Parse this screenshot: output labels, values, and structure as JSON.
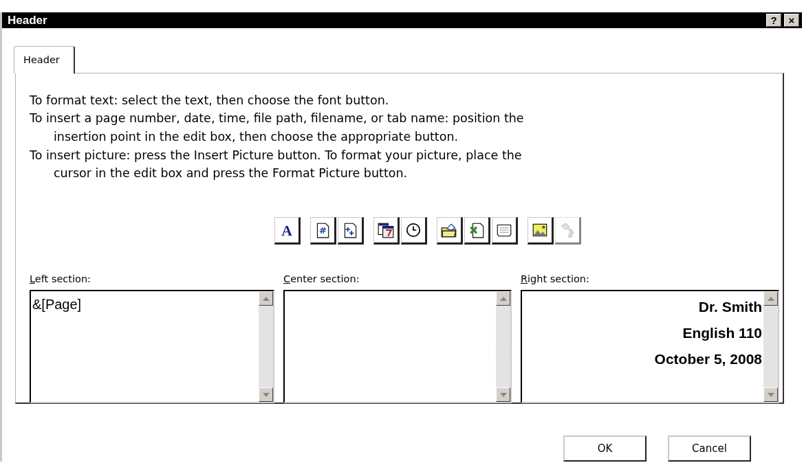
{
  "window": {
    "title": "Header",
    "help_button": "?",
    "close_button": "×"
  },
  "tabs": [
    {
      "label": "Header",
      "selected": true
    }
  ],
  "instructions": [
    {
      "lines": [
        "To format text:  select the text, then choose the font button."
      ]
    },
    {
      "lines": [
        "To insert a page number, date, time, file path, filename, or tab name:  position the",
        "insertion point in the edit box, then choose the appropriate button."
      ]
    },
    {
      "lines": [
        "To insert picture: press the Insert Picture button.  To format your picture, place the",
        "cursor in the edit box and press the Format Picture button."
      ]
    }
  ],
  "toolbar": [
    [
      {
        "kind": "font",
        "glyph": "A",
        "disabled": false
      }
    ],
    [
      {
        "kind": "page-number",
        "glyph": "#",
        "disabled": false
      },
      {
        "kind": "page-count",
        "disabled": false
      }
    ],
    [
      {
        "kind": "date",
        "disabled": false
      },
      {
        "kind": "time",
        "disabled": false
      }
    ],
    [
      {
        "kind": "file-path",
        "disabled": false
      },
      {
        "kind": "file-name",
        "disabled": false
      },
      {
        "kind": "sheet-name",
        "disabled": false
      }
    ],
    [
      {
        "kind": "picture",
        "disabled": false
      },
      {
        "kind": "format-picture",
        "disabled": true
      }
    ]
  ],
  "sections": [
    {
      "label": "Left section:",
      "lines": [
        "&[Page]"
      ]
    },
    {
      "label": "Center section:"
    },
    {
      "label": "Right section:",
      "bold": true,
      "lines": [
        "Dr. Smith",
        "English 110",
        "October 5, 2008"
      ]
    }
  ],
  "buttons": [
    {
      "label": "OK"
    },
    {
      "label": "Cancel"
    }
  ]
}
